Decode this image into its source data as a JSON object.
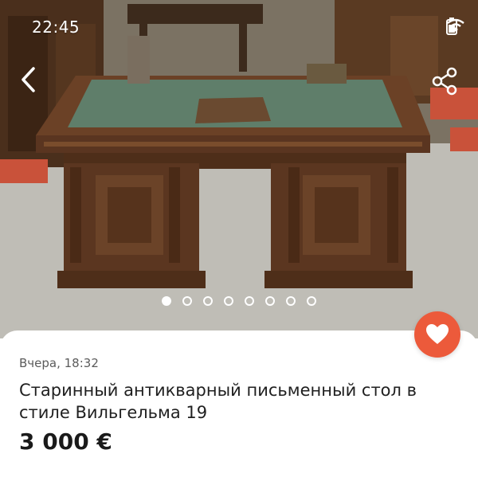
{
  "status_bar": {
    "time": "22:45",
    "icons": [
      "wifi-icon",
      "battery-icon"
    ]
  },
  "toolbar": {
    "back_icon": "chevron-left-icon",
    "share_icon": "share-icon"
  },
  "gallery": {
    "image_count": 8,
    "active_index": 0
  },
  "listing": {
    "date": "Вчера, 18:32",
    "title": "Старинный антикварный письменный стол в стиле Вильгельма 19",
    "price": "3 000 €",
    "favorite_icon": "heart-icon"
  },
  "colors": {
    "accent": "#ec5a3b",
    "text": "#1f1f1f",
    "secondary_text": "#5b5b5b"
  }
}
